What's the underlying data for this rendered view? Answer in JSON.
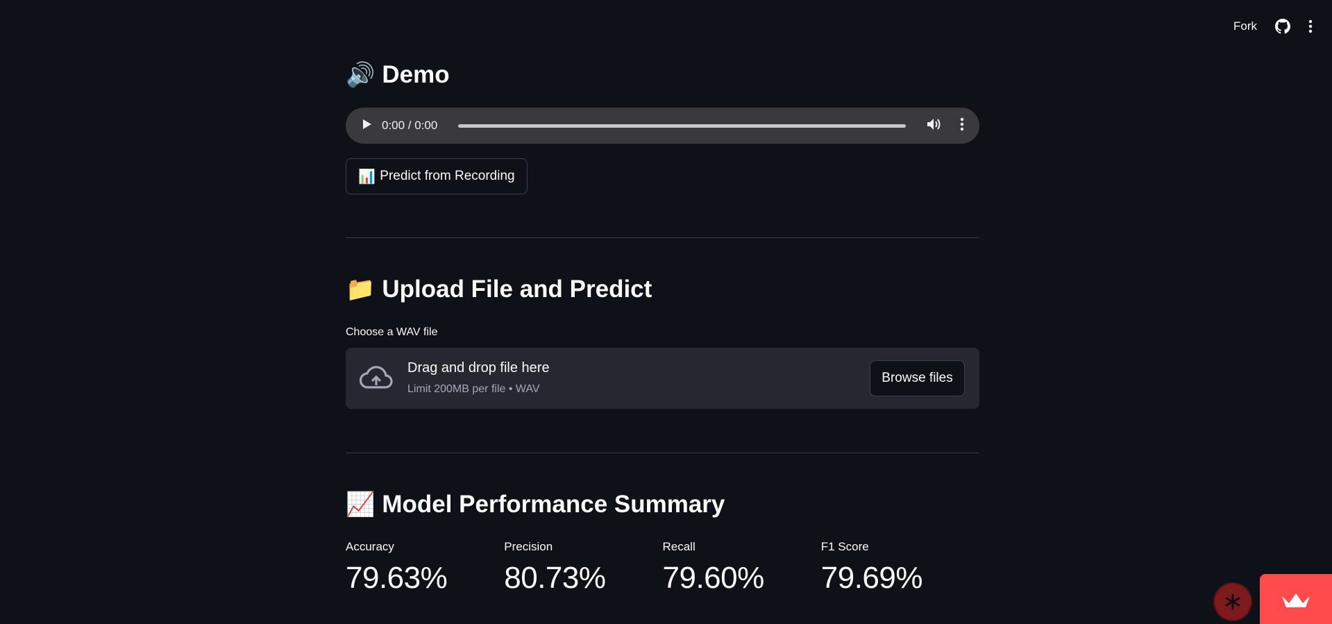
{
  "header": {
    "fork_label": "Fork",
    "github_icon": "github-icon",
    "menu_icon": "kebab-menu-icon"
  },
  "demo": {
    "emoji": "🔊",
    "title": "Demo",
    "audio": {
      "time": "0:00 / 0:00",
      "play_icon": "play-icon",
      "volume_icon": "volume-icon",
      "more_icon": "more-options-icon"
    },
    "predict_button": {
      "emoji": "📊",
      "label": "Predict from Recording"
    }
  },
  "upload": {
    "emoji": "📁",
    "title": "Upload File and Predict",
    "field_label": "Choose a WAV file",
    "dropzone": {
      "title": "Drag and drop file here",
      "subtitle": "Limit 200MB per file • WAV",
      "icon": "cloud-upload-icon"
    },
    "browse_button": "Browse files"
  },
  "performance": {
    "emoji": "📈",
    "title": "Model Performance Summary",
    "metrics": [
      {
        "label": "Accuracy",
        "value": "79.63%"
      },
      {
        "label": "Precision",
        "value": "80.73%"
      },
      {
        "label": "Recall",
        "value": "79.60%"
      },
      {
        "label": "F1 Score",
        "value": "79.69%"
      }
    ]
  },
  "colors": {
    "background": "#0e1117",
    "surface": "#262730",
    "audio_bar": "#3a3a3c",
    "accent": "#ff4b4b",
    "text": "#fafafa",
    "muted_text": "#a3a8b8"
  }
}
